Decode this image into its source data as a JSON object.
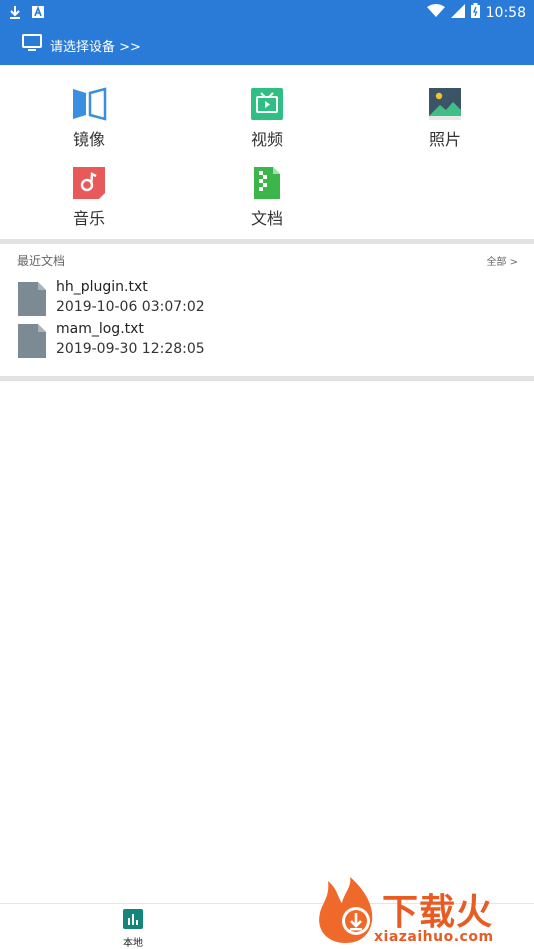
{
  "status_bar": {
    "time": "10:58",
    "icons": [
      "download-icon",
      "notification-a-icon",
      "wifi-icon",
      "signal-icon",
      "battery-icon"
    ]
  },
  "app_bar": {
    "device_select_label": "请选择设备 >>",
    "icon": "monitor-icon"
  },
  "categories": [
    {
      "label": "镜像",
      "icon": "mirror-icon",
      "color": "#3a8fe0"
    },
    {
      "label": "视频",
      "icon": "video-icon",
      "color": "#2fbf84"
    },
    {
      "label": "照片",
      "icon": "photo-icon",
      "color": "#3c5566"
    },
    {
      "label": "音乐",
      "icon": "music-icon",
      "color": "#e85a5a"
    },
    {
      "label": "文档",
      "icon": "document-icon",
      "color": "#3cb54a"
    }
  ],
  "recent": {
    "title": "最近文档",
    "all_label": "全部 >",
    "files": [
      {
        "name": "hh_plugin.txt",
        "date": "2019-10-06 03:07:02"
      },
      {
        "name": "mam_log.txt",
        "date": "2019-09-30 12:28:05"
      }
    ]
  },
  "bottom_nav": {
    "local_label": "本地",
    "icon": "bar-chart-icon",
    "accent": "#14857a"
  },
  "watermark": {
    "text": "下载火",
    "url": "xiazaihuo.com"
  }
}
